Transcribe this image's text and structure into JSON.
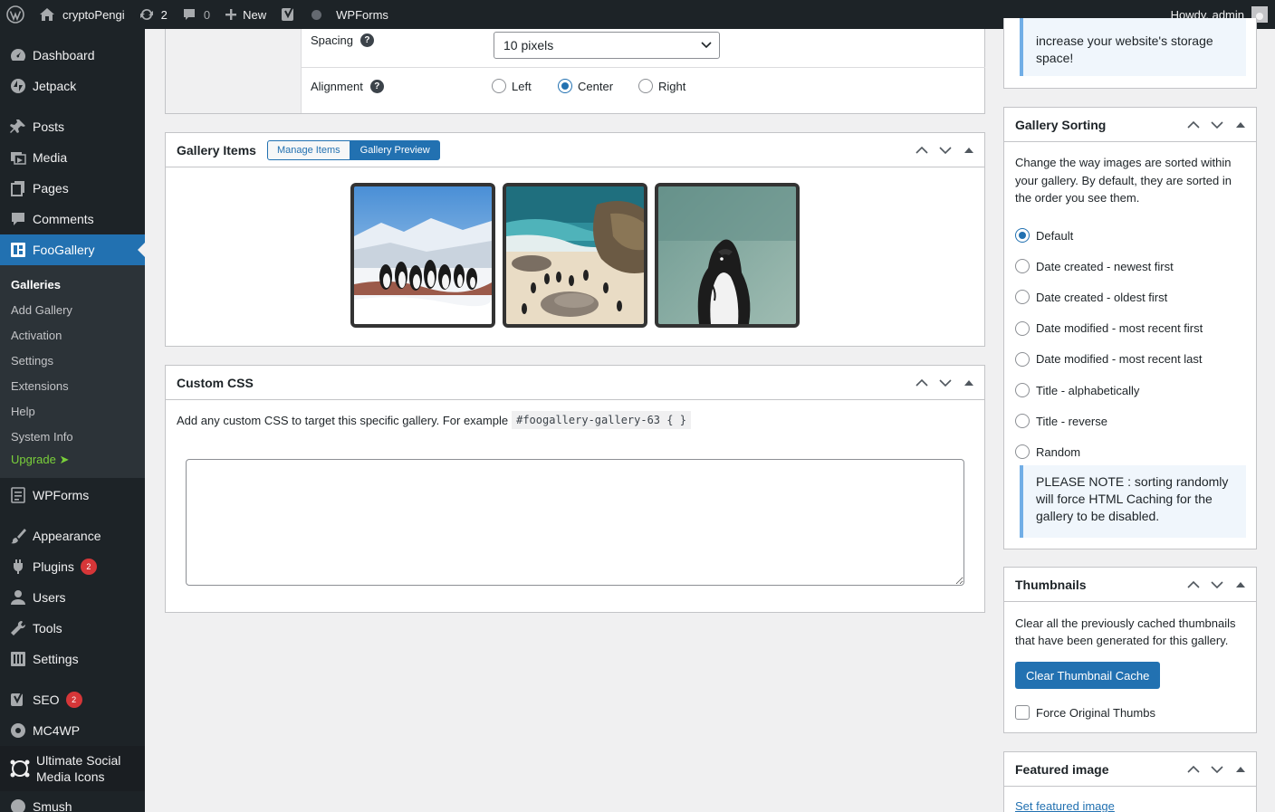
{
  "adminbar": {
    "site_name": "cryptoPengi",
    "updates_count": "2",
    "comments_count": "0",
    "new_label": "New",
    "wpforms_label": "WPForms",
    "howdy": "Howdy, admin"
  },
  "sidebar": {
    "dashboard": "Dashboard",
    "jetpack": "Jetpack",
    "posts": "Posts",
    "media": "Media",
    "pages": "Pages",
    "comments": "Comments",
    "foogallery": "FooGallery",
    "sub": {
      "galleries": "Galleries",
      "add_gallery": "Add Gallery",
      "activation": "Activation",
      "settings": "Settings",
      "extensions": "Extensions",
      "help": "Help",
      "system_info": "System Info",
      "upgrade": "Upgrade ➤"
    },
    "wpforms": "WPForms",
    "appearance": "Appearance",
    "plugins": "Plugins",
    "plugins_badge": "2",
    "users": "Users",
    "tools": "Tools",
    "settings": "Settings",
    "seo": "SEO",
    "seo_badge": "2",
    "mc4wp": "MC4WP",
    "usm_line1": "Ultimate Social",
    "usm_line2": "Media Icons",
    "smush": "Smush"
  },
  "settings_top": {
    "spacing_label": "Spacing",
    "spacing_value": "10 pixels",
    "alignment_label": "Alignment",
    "align_left": "Left",
    "align_center": "Center",
    "align_right": "Right",
    "alignment_selected": "Center"
  },
  "gallery_items": {
    "title": "Gallery Items",
    "manage_items": "Manage Items",
    "gallery_preview": "Gallery Preview"
  },
  "custom_css": {
    "title": "Custom CSS",
    "description": "Add any custom CSS to target this specific gallery. For example",
    "example": "#foogallery-gallery-63 { }",
    "textarea_value": ""
  },
  "storage_notice": {
    "line1": "increase your website's storage",
    "line2": "space!"
  },
  "gallery_sorting": {
    "title": "Gallery Sorting",
    "description": "Change the way images are sorted within your gallery. By default, they are sorted in the order you see them.",
    "options": [
      "Default",
      "Date created - newest first",
      "Date created - oldest first",
      "Date modified - most recent first",
      "Date modified - most recent last",
      "Title - alphabetically",
      "Title - reverse",
      "Random"
    ],
    "selected": "Default",
    "note": "PLEASE NOTE : sorting randomly will force HTML Caching for the gallery to be disabled."
  },
  "thumbnails": {
    "title": "Thumbnails",
    "description": "Clear all the previously cached thumbnails that have been generated for this gallery.",
    "clear_button": "Clear Thumbnail Cache",
    "force_label": "Force Original Thumbs"
  },
  "featured_image": {
    "title": "Featured image",
    "set_link": "Set featured image"
  },
  "colors": {
    "admin_dark": "#1d2327",
    "accent": "#2271b1",
    "badge": "#d63638",
    "upgrade": "#7ad03a"
  }
}
